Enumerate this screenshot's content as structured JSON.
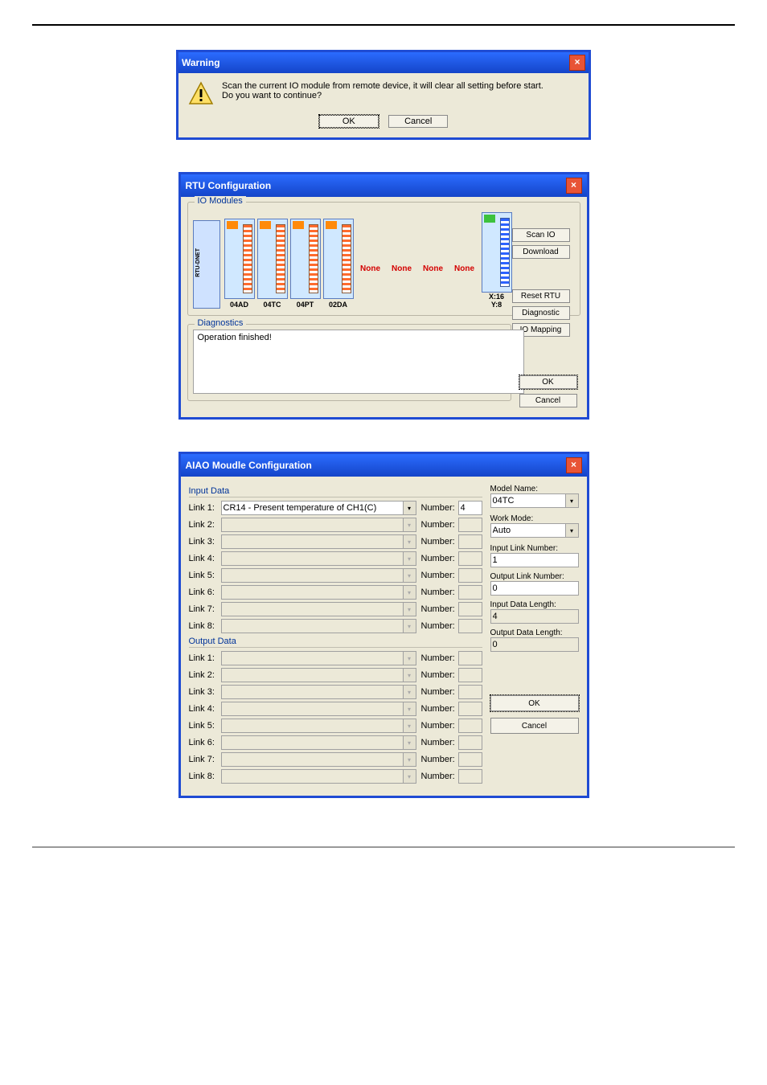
{
  "warning": {
    "title": "Warning",
    "msg_line1": "Scan the current IO module from remote device, it will clear all setting before start.",
    "msg_line2": "Do you want to continue?",
    "ok": "OK",
    "cancel": "Cancel"
  },
  "rtu": {
    "title": "RTU Configuration",
    "io_modules_label": "IO Modules",
    "modules": [
      "04AD",
      "04TC",
      "04PT",
      "02DA"
    ],
    "none": "None",
    "xy": {
      "x": "X:16",
      "y": "Y:8"
    },
    "rtu_vtxt": "RTU-DNET",
    "buttons": {
      "scan": "Scan IO",
      "download": "Download",
      "reset": "Reset RTU",
      "diagnostic": "Diagnostic",
      "mapping": "IO Mapping"
    },
    "diag_label": "Diagnostics",
    "diag_msg": "Operation finished!",
    "ok": "OK",
    "cancel": "Cancel"
  },
  "aiao": {
    "title": "AIAO Moudle Configuration",
    "input_label": "Input Data",
    "output_label": "Output Data",
    "link_label_prefix": "Link ",
    "number_label": "Number:",
    "input_links": [
      {
        "label": "Link 1:",
        "sel": "CR14 - Present temperature of CH1(C)",
        "num": "4",
        "enabled": true
      },
      {
        "label": "Link 2:",
        "sel": "",
        "num": "",
        "enabled": false
      },
      {
        "label": "Link 3:",
        "sel": "",
        "num": "",
        "enabled": false
      },
      {
        "label": "Link 4:",
        "sel": "",
        "num": "",
        "enabled": false
      },
      {
        "label": "Link 5:",
        "sel": "",
        "num": "",
        "enabled": false
      },
      {
        "label": "Link 6:",
        "sel": "",
        "num": "",
        "enabled": false
      },
      {
        "label": "Link 7:",
        "sel": "",
        "num": "",
        "enabled": false
      },
      {
        "label": "Link 8:",
        "sel": "",
        "num": "",
        "enabled": false
      }
    ],
    "output_links": [
      {
        "label": "Link 1:"
      },
      {
        "label": "Link 2:"
      },
      {
        "label": "Link 3:"
      },
      {
        "label": "Link 4:"
      },
      {
        "label": "Link 5:"
      },
      {
        "label": "Link 6:"
      },
      {
        "label": "Link 7:"
      },
      {
        "label": "Link 8:"
      }
    ],
    "right": {
      "model_name_lbl": "Model Name:",
      "model_name": "04TC",
      "work_mode_lbl": "Work Mode:",
      "work_mode": "Auto",
      "in_link_num_lbl": "Input Link Number:",
      "in_link_num": "1",
      "out_link_num_lbl": "Output Link Number:",
      "out_link_num": "0",
      "in_len_lbl": "Input Data Length:",
      "in_len": "4",
      "out_len_lbl": "Output Data Length:",
      "out_len": "0"
    },
    "ok": "OK",
    "cancel": "Cancel"
  }
}
